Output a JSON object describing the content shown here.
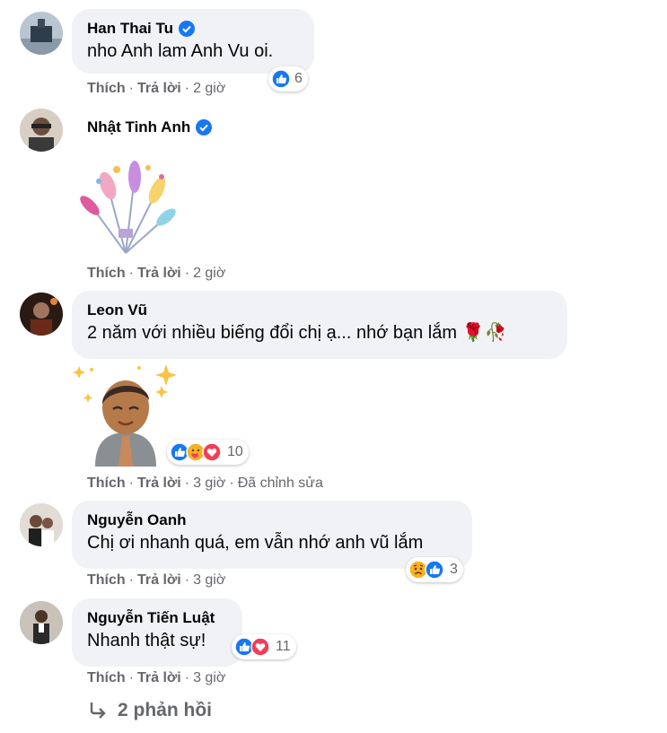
{
  "comments": [
    {
      "author": "Han Thai Tu",
      "verified": true,
      "text": "nho Anh lam Anh Vu oi.",
      "like_label": "Thích",
      "reply_label": "Trả lời",
      "time": "2 giờ",
      "reaction_count": "6",
      "reaction_icons": [
        "like-icon"
      ]
    },
    {
      "author": "Nhật Tinh Anh",
      "verified": true,
      "sticker": "flower-bouquet-sticker",
      "like_label": "Thích",
      "reply_label": "Trả lời",
      "time": "2 giờ"
    },
    {
      "author": "Leon Vũ",
      "verified": false,
      "text": "2 năm với nhiều biếng đổi chị ạ... nhớ bạn lắm 🌹🥀",
      "sticker": "praying-man-sticker",
      "like_label": "Thích",
      "reply_label": "Trả lời",
      "time": "3 giờ",
      "edited": "Đã chỉnh sửa",
      "reaction_count": "10",
      "reaction_icons": [
        "like-icon",
        "care-icon",
        "love-icon"
      ]
    },
    {
      "author": "Nguyễn Oanh",
      "verified": false,
      "text": "Chị ơi nhanh quá, em vẫn nhớ anh vũ lắm",
      "like_label": "Thích",
      "reply_label": "Trả lời",
      "time": "3 giờ",
      "reaction_count": "3",
      "reaction_icons": [
        "sad-icon",
        "like-icon"
      ]
    },
    {
      "author": "Nguyễn Tiến Luật",
      "verified": false,
      "text": "Nhanh thật sự!",
      "like_label": "Thích",
      "reply_label": "Trả lời",
      "time": "3 giờ",
      "reaction_count": "11",
      "reaction_icons": [
        "like-icon",
        "love-icon"
      ]
    }
  ],
  "replies_link": "2 phản hồi",
  "colors": {
    "bubble": "#f0f2f5",
    "meta_text": "#65676b",
    "like_blue": "#1877f2",
    "love_red": "#f33e58",
    "verified_blue": "#1877f2"
  }
}
